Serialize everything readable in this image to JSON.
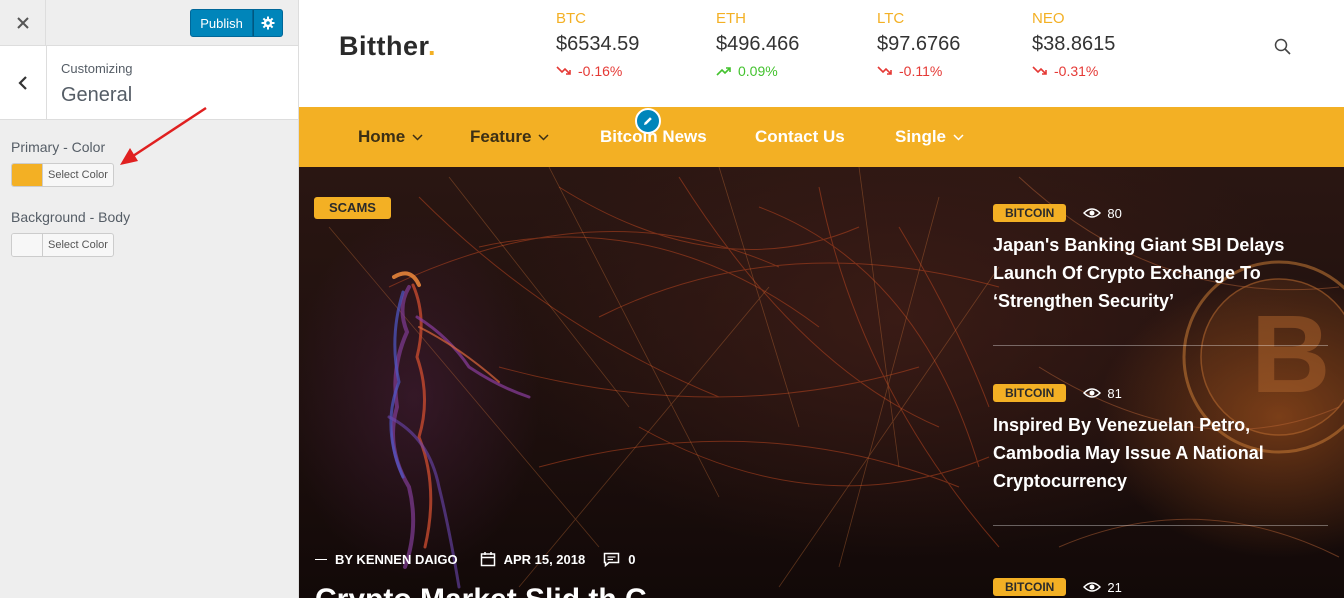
{
  "customizer": {
    "publish_label": "Publish",
    "breadcrumb": "Customizing",
    "section_title": "General",
    "controls": [
      {
        "label": "Primary - Color",
        "button_text": "Select Color",
        "swatch_color": "#f3b024"
      },
      {
        "label": "Background - Body",
        "button_text": "Select Color",
        "swatch_color": "#f7f7f7"
      }
    ],
    "accent_color": "#0085ba"
  },
  "site": {
    "logo_text": "Bitther",
    "logo_dot": ".",
    "brand_color": "#f3b024",
    "tickers": [
      {
        "symbol": "BTC",
        "price": "$6534.59",
        "change": "-0.16%",
        "direction": "down"
      },
      {
        "symbol": "ETH",
        "price": "$496.466",
        "change": "0.09%",
        "direction": "up"
      },
      {
        "symbol": "LTC",
        "price": "$97.6766",
        "change": "-0.11%",
        "direction": "down"
      },
      {
        "symbol": "NEO",
        "price": "$38.8615",
        "change": "-0.31%",
        "direction": "down"
      }
    ],
    "nav": [
      {
        "label": "Home",
        "has_dropdown": true
      },
      {
        "label": "Feature",
        "has_dropdown": true
      },
      {
        "label": "Bitcoin News",
        "has_dropdown": false
      },
      {
        "label": "Contact Us",
        "has_dropdown": false
      },
      {
        "label": "Single",
        "has_dropdown": true
      }
    ],
    "hero": {
      "tag": "SCAMS",
      "author": "BY KENNEN DAIGO",
      "date": "APR 15, 2018",
      "comments": "0",
      "title": "Crypto Market Slid th C..."
    },
    "side_posts": [
      {
        "tag": "BITCOIN",
        "views": "80",
        "title": "Japan's Banking Giant SBI Delays Launch Of Crypto Exchange To ‘Strengthen Security’"
      },
      {
        "tag": "BITCOIN",
        "views": "81",
        "title": "Inspired By Venezuelan Petro, Cambodia May Issue A National Cryptocurrency"
      },
      {
        "tag": "BITCOIN",
        "views": "21",
        "title": ""
      }
    ]
  }
}
